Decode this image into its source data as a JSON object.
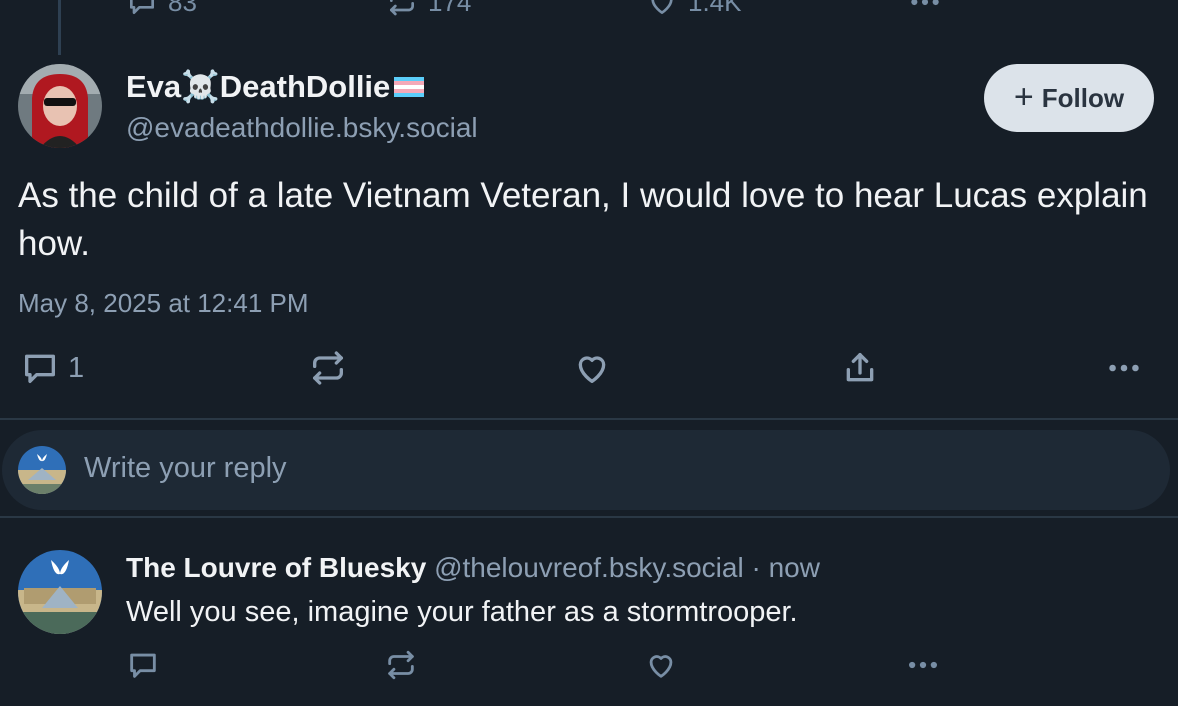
{
  "colors": {
    "background": "#161e27",
    "text_primary": "#f1f3f5",
    "text_secondary": "#8d9fb3",
    "follow_button_bg": "#dce3ea",
    "thread_line": "#2e4052"
  },
  "previous_post": {
    "reply_count": "83",
    "repost_count": "174",
    "like_count": "1.4K"
  },
  "post": {
    "display_name": "Eva☠️DeathDollie",
    "handle": "@evadeathdollie.bsky.social",
    "follow_label": "Follow",
    "text": "As the child of a late Vietnam Veteran, I would love to hear Lucas explain how.",
    "timestamp": "May 8, 2025 at 12:41 PM",
    "reply_count": "1",
    "icons": [
      "reply-icon",
      "repost-icon",
      "like-icon",
      "share-icon",
      "more-icon"
    ]
  },
  "composer": {
    "placeholder": "Write your reply"
  },
  "reply": {
    "display_name": "The Louvre of Bluesky",
    "handle": "@thelouvreof.bsky.social",
    "separator": " · ",
    "time": "now",
    "text": "Well you see, imagine your father as a stormtrooper."
  }
}
